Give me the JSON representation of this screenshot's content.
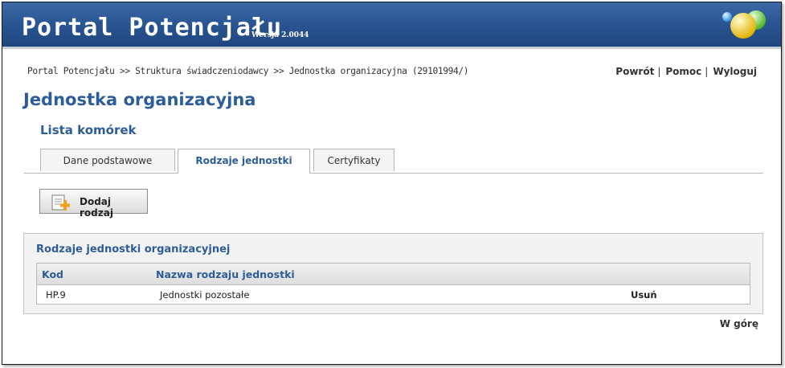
{
  "header": {
    "app_title": "Portal Potencjału",
    "version": "Wersja 2.0044"
  },
  "breadcrumb": "Portal Potencjału >> Struktura świadczeniodawcy >> Jednostka organizacyjna (29101994/)",
  "toplinks": {
    "back": "Powrót",
    "help": "Pomoc",
    "logout": "Wyloguj",
    "sep": "|"
  },
  "page_title": "Jednostka organizacyjna",
  "subtitle": "Lista komórek",
  "tabs": [
    {
      "label": "Dane podstawowe",
      "active": false
    },
    {
      "label": "Rodzaje jednostki",
      "active": true
    },
    {
      "label": "Certyfikaty",
      "active": false
    }
  ],
  "add_button": {
    "label": "Dodaj rodzaj",
    "icon": "document-add-icon"
  },
  "panel": {
    "title": "Rodzaje jednostki organizacyjnej",
    "columns": [
      "Kod",
      "Nazwa rodzaju jednostki"
    ],
    "rows": [
      {
        "code": "HP.9",
        "name": "Jednostki pozostałe",
        "action": "Usuń"
      }
    ]
  },
  "to_top": "W górę",
  "colors": {
    "header_blue": "#2b5694",
    "title_blue": "#2d5d99"
  }
}
